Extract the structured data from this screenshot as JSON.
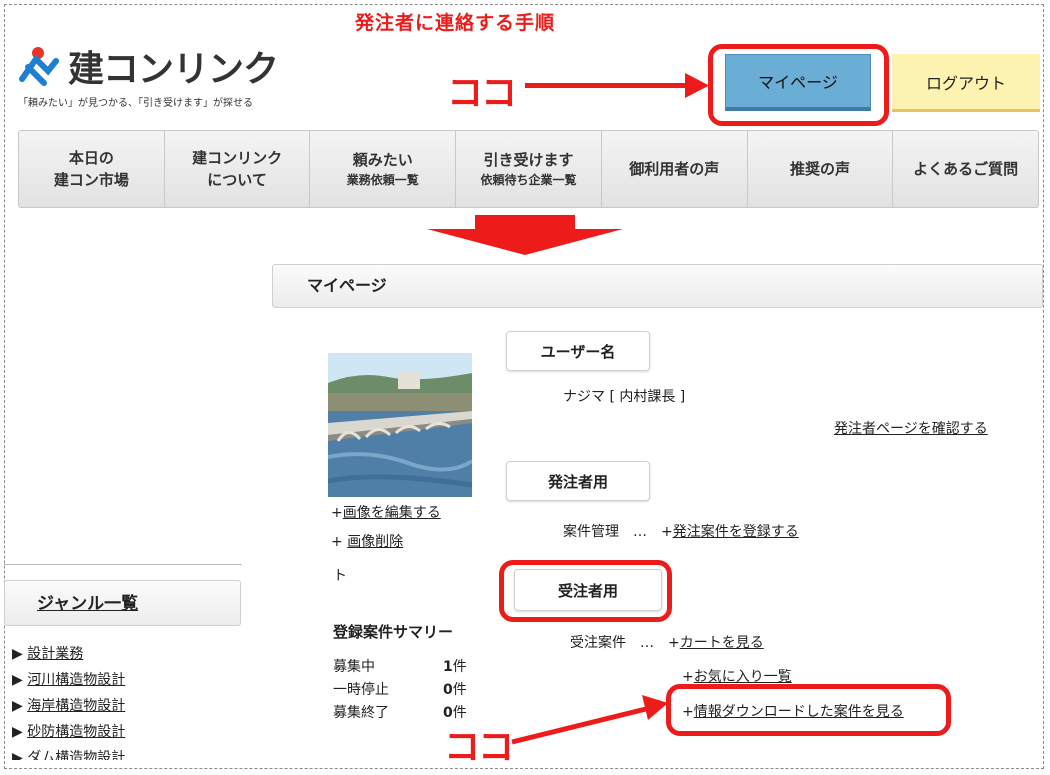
{
  "heading": "発注者に連絡する手順",
  "logo": {
    "name": "建コンリンク",
    "tagline": "「頼みたい」が見つかる、「引き受けます」が探せる"
  },
  "koko_label": "ココ",
  "header_buttons": {
    "mypage": "マイページ",
    "logout": "ログアウト"
  },
  "nav": [
    {
      "line1": "本日の",
      "line2": "建コン市場"
    },
    {
      "line1": "建コンリンク",
      "line2": "について"
    },
    {
      "line1": "頼みたい",
      "line2": "業務依頼一覧"
    },
    {
      "line1": "引き受けます",
      "line2": "依頼待ち企業一覧"
    },
    {
      "line1": "御利用者の声",
      "line2": ""
    },
    {
      "line1": "推奨の声",
      "line2": ""
    },
    {
      "line1": "よくあるご質問",
      "line2": ""
    }
  ],
  "mypage_title": "マイページ",
  "profile": {
    "edit_image_prefix": "+",
    "edit_image": "画像を編集する",
    "delete_image_prefix": "+ ",
    "delete_image": "画像削除",
    "stray": "ト"
  },
  "user": {
    "label": "ユーザー名",
    "name": "ナジマ [ 内村課長 ]",
    "orderer_page_link": "発注者ページを確認する"
  },
  "orderer": {
    "label": "発注者用",
    "mgmt": "案件管理　…　+",
    "register": "発注案件を登録する"
  },
  "contractor": {
    "label": "受注者用",
    "case": "受注案件　…　+",
    "cart": "カートを見る",
    "fav_prefix": "+",
    "fav": "お気に入り一覧",
    "dl_prefix": "+",
    "dl": "情報ダウンロードした案件を見る"
  },
  "genre": {
    "title": "ジャンル一覧",
    "items": [
      "設計業務",
      "河川構造物設計",
      "海岸構造物設計",
      "砂防構造物設計",
      "ダム構造物設計"
    ]
  },
  "summary": {
    "title": "登録案件サマリー",
    "rows": [
      {
        "label": "募集中",
        "count": "1",
        "unit": "件"
      },
      {
        "label": "一時停止",
        "count": "0",
        "unit": "件"
      },
      {
        "label": "募集終了",
        "count": "0",
        "unit": "件"
      }
    ]
  },
  "colors": {
    "annotation_red": "#ee1b1b",
    "mypage_button": "#6aaed6",
    "logout_button": "#fdf3b0"
  },
  "icons": [
    "logo-mark-icon",
    "right-arrow-icon",
    "down-arrow-icon",
    "triangle-bullet-icon"
  ]
}
